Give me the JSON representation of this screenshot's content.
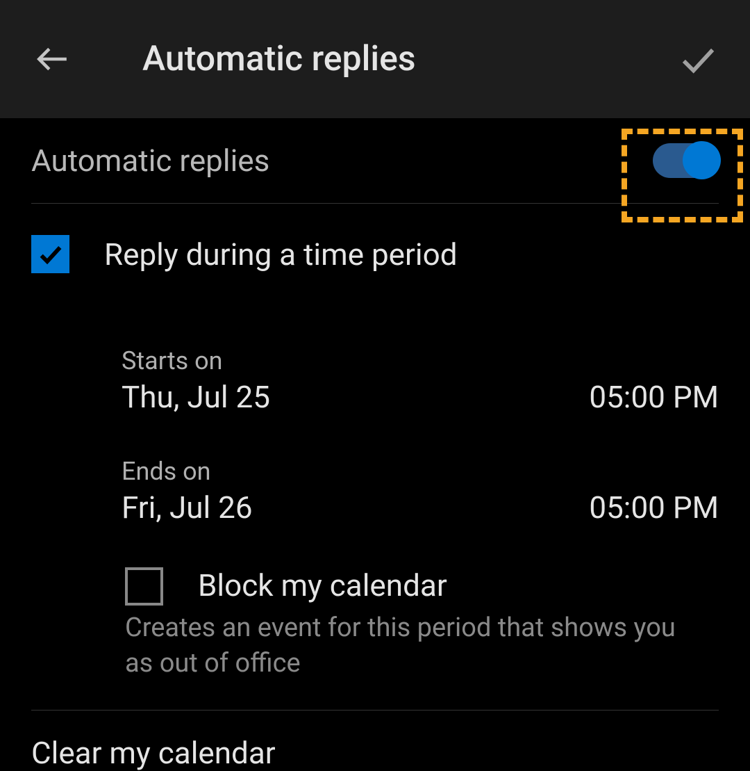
{
  "header": {
    "title": "Automatic replies"
  },
  "toggle": {
    "label": "Automatic replies",
    "enabled": true
  },
  "timePeriod": {
    "checkboxLabel": "Reply during a time period",
    "checked": true,
    "starts": {
      "label": "Starts on",
      "date": "Thu, Jul 25",
      "time": "05:00 PM"
    },
    "ends": {
      "label": "Ends on",
      "date": "Fri, Jul 26",
      "time": "05:00 PM"
    }
  },
  "blockCalendar": {
    "label": "Block my calendar",
    "description": "Creates an event for this period that shows you as out of office",
    "checked": false
  },
  "clearCalendar": {
    "label": "Clear my calendar"
  }
}
